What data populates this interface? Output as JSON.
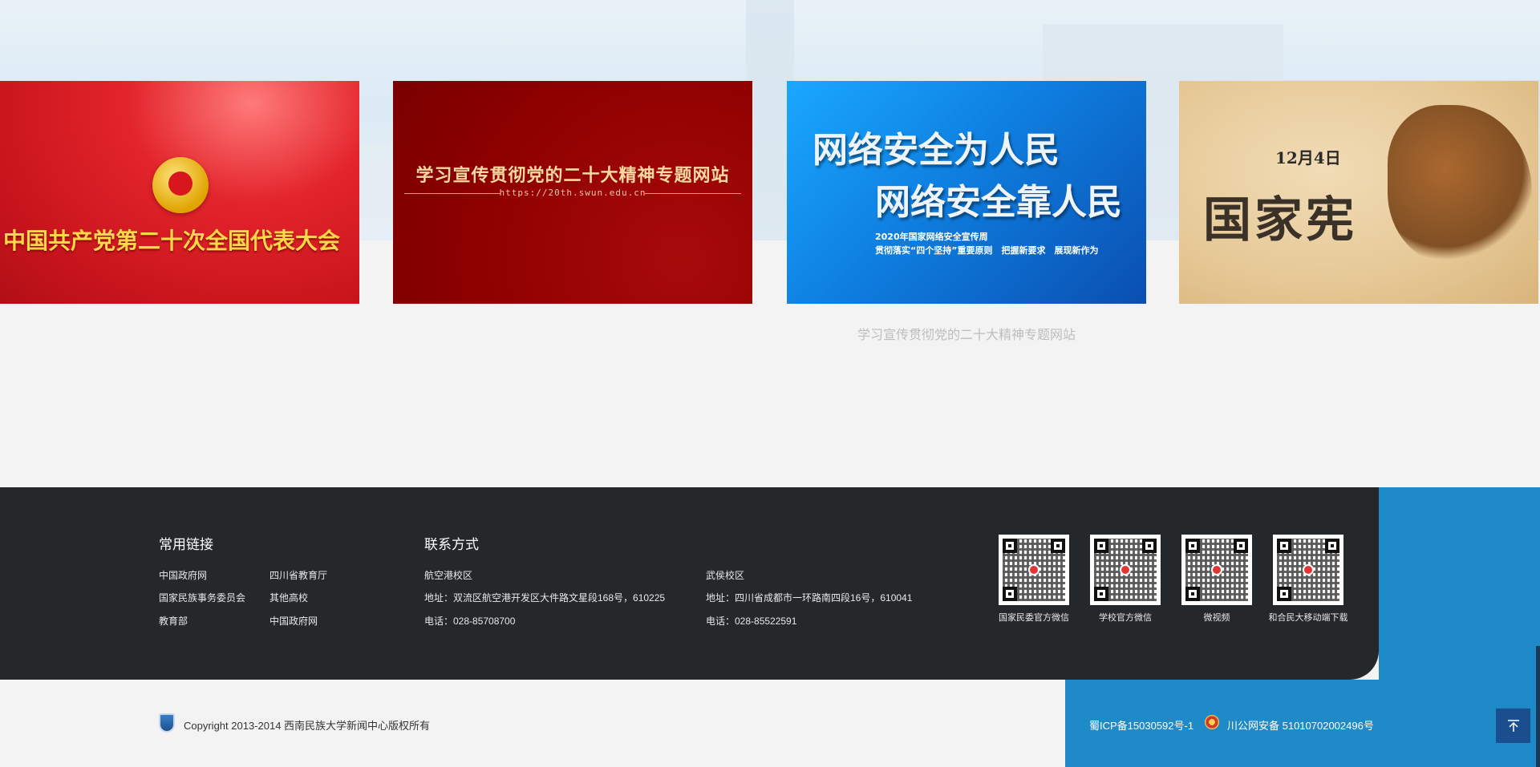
{
  "banners": [
    {
      "title": "中国共产党第二十次全国代表大会"
    },
    {
      "title": "学习宣传贯彻党的二十大精神专题网站",
      "url": "https://20th.swun.edu.cn"
    },
    {
      "line1": "网络安全为人民",
      "line2": "网络安全靠人民",
      "sub1": "2020年国家网络安全宣传周",
      "sub2": "贯彻落实“四个坚持”重要原则　把握新要求　展现新作为"
    },
    {
      "date": "12月4日",
      "title": "国家宪"
    }
  ],
  "caption": "学习宣传贯彻党的二十大精神专题网站",
  "footer": {
    "links_title": "常用链接",
    "links": [
      "中国政府网",
      "四川省教育厅",
      "国家民族事务委员会",
      "其他高校",
      "教育部",
      "中国政府网"
    ],
    "contact_title": "联系方式",
    "campus1": {
      "name": "航空港校区",
      "address": "地址：双流区航空港开发区大件路文星段168号，610225",
      "phone": "电话：028-85708700"
    },
    "campus2": {
      "name": "武侯校区",
      "address": "地址：四川省成都市一环路南四段16号，610041",
      "phone": "电话：028-85522591"
    },
    "qrcodes": [
      {
        "label": "国家民委官方微信"
      },
      {
        "label": "学校官方微信"
      },
      {
        "label": "微视频"
      },
      {
        "label": "和合民大移动端下载"
      }
    ]
  },
  "bottom": {
    "copyright": "Copyright 2013-2014 西南民族大学新闻中心版权所有",
    "icp": "蜀ICP备15030592号-1",
    "police": "川公网安备 51010702002496号"
  }
}
